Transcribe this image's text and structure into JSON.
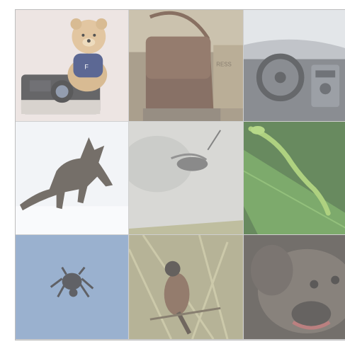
{
  "collage": {
    "rows": 3,
    "columns": 3,
    "tiles": [
      {
        "id": "teddy-bear-camera",
        "bg": "#d9d3cf"
      },
      {
        "id": "leather-satchel",
        "bg": "#7d6a55"
      },
      {
        "id": "car-interior",
        "bg": "#9ea3a9"
      },
      {
        "id": "wolf-in-snow",
        "bg": "#e8eaef"
      },
      {
        "id": "insect-on-twig",
        "bg": "#c8c9c4"
      },
      {
        "id": "green-lizard-leaf",
        "bg": "#3a6a2a"
      },
      {
        "id": "bug-in-sky",
        "bg": "#6f8fb8"
      },
      {
        "id": "bird-on-branch",
        "bg": "#8e8b6a"
      },
      {
        "id": "dog-closeup",
        "bg": "#3b3633"
      }
    ]
  }
}
